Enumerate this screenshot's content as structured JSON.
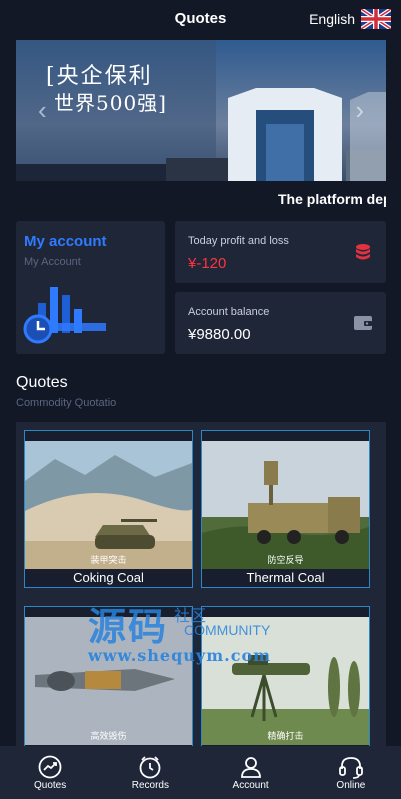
{
  "header": {
    "title": "Quotes",
    "language": "English",
    "flag_icon": "uk-flag-icon"
  },
  "banner": {
    "headline_line1": "[央企保利",
    "headline_line2": "世界500强]",
    "prev_icon": "chevron-left-icon",
    "next_icon": "chevron-right-icon"
  },
  "notice": {
    "text": "The platform depo"
  },
  "account": {
    "title": "My account",
    "subtitle": "My Account"
  },
  "profit": {
    "label": "Today profit and loss",
    "value": "¥-120",
    "icon": "coins-icon",
    "color": "#ff3342"
  },
  "balance": {
    "label": "Account balance",
    "value": "¥9880.00",
    "icon": "wallet-icon"
  },
  "quotes": {
    "title": "Quotes",
    "subtitle": "Commodity Quotatio",
    "items": [
      {
        "caption": "装甲突击",
        "name": "Coking Coal"
      },
      {
        "caption": "防空反导",
        "name": "Thermal Coal"
      },
      {
        "caption": "高效毁伤",
        "name": ""
      },
      {
        "caption": "精确打击",
        "name": ""
      }
    ]
  },
  "watermark": {
    "big": "源码",
    "small": "社区",
    "community": "COMMUNITY",
    "url": "www.shequym.com"
  },
  "tabbar": {
    "items": [
      {
        "label": "Quotes",
        "icon": "trend-chart-icon"
      },
      {
        "label": "Records",
        "icon": "clock-icon"
      },
      {
        "label": "Account",
        "icon": "user-icon"
      },
      {
        "label": "Online",
        "icon": "headset-icon"
      }
    ]
  },
  "colors": {
    "background": "#121826",
    "card": "#1f2638",
    "accent": "#2f7bff",
    "loss": "#ff3342"
  }
}
